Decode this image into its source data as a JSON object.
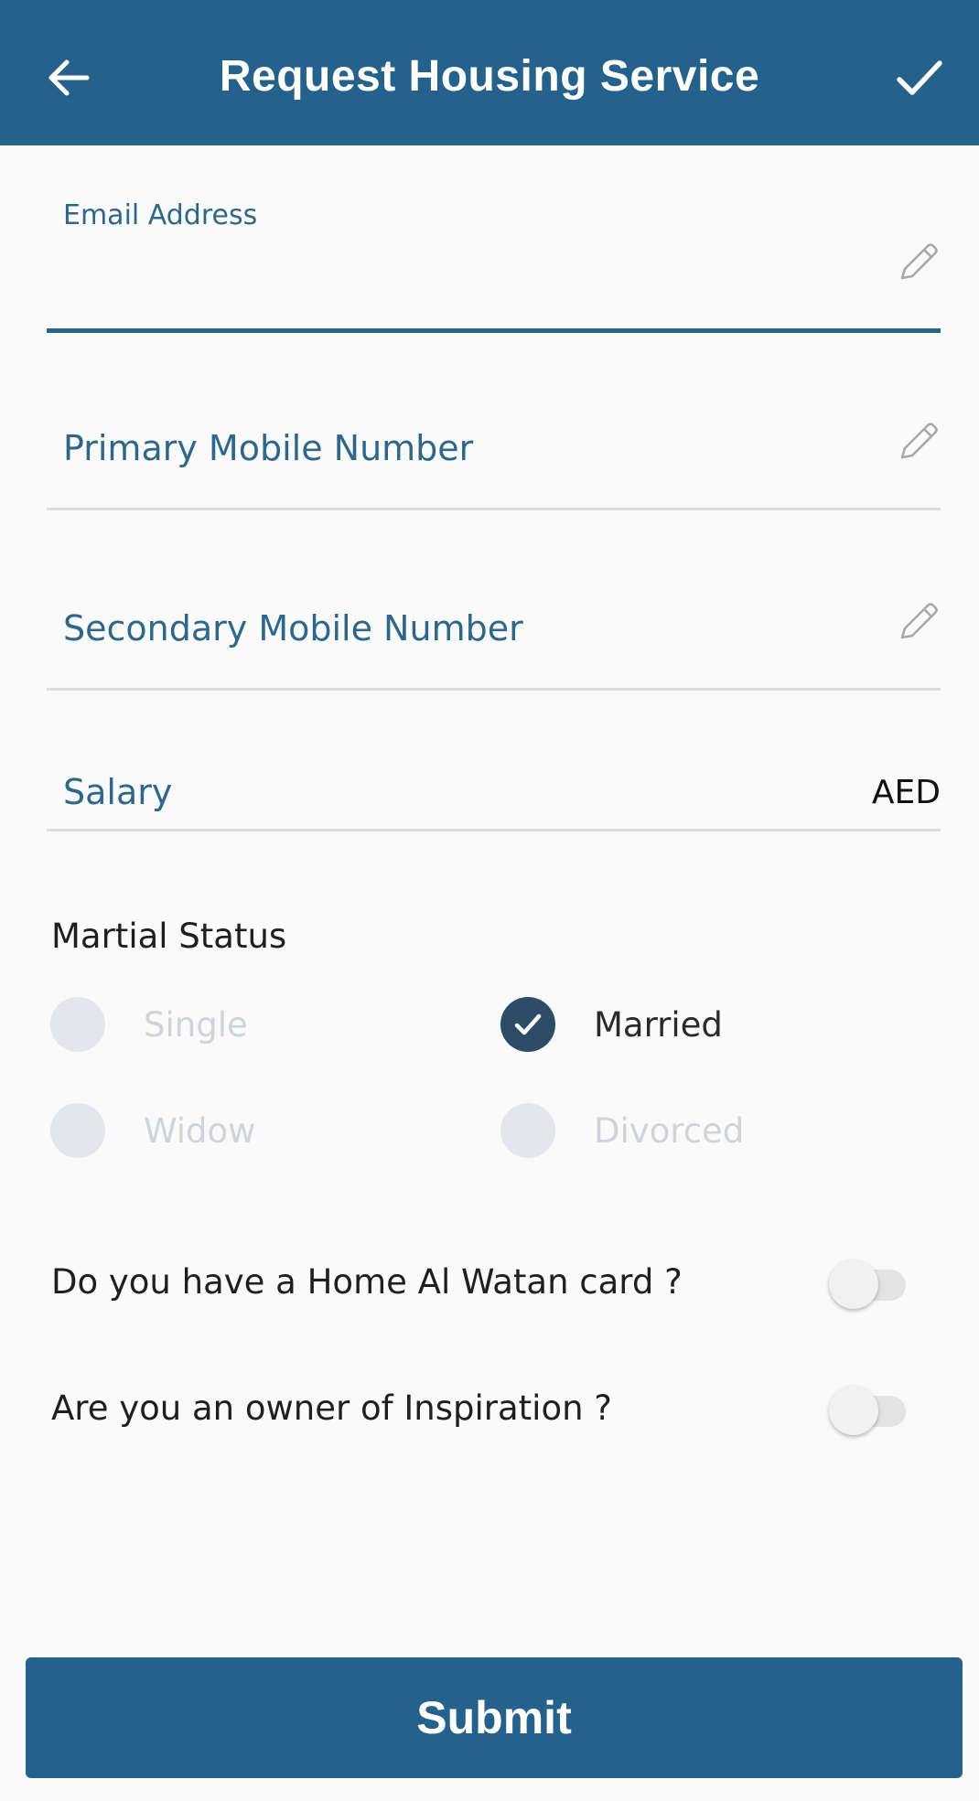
{
  "appbar": {
    "title": "Request Housing Service",
    "back_icon": "arrow-left-icon",
    "confirm_icon": "checkmark-icon"
  },
  "form": {
    "email": {
      "label": "Email Address",
      "value": "",
      "icon": "pencil-icon"
    },
    "primary_mobile": {
      "label": "Primary Mobile Number",
      "value": "",
      "icon": "pencil-icon"
    },
    "secondary_mobile": {
      "label": "Secondary Mobile Number",
      "value": "",
      "icon": "pencil-icon"
    },
    "salary": {
      "label": "Salary",
      "value": "",
      "suffix": "AED"
    }
  },
  "marital_status": {
    "title": "Martial Status",
    "options": [
      {
        "label": "Single",
        "selected": false
      },
      {
        "label": "Married",
        "selected": true
      },
      {
        "label": "Widow",
        "selected": false
      },
      {
        "label": "Divorced",
        "selected": false
      }
    ]
  },
  "questions": [
    {
      "text": "Do you have a Home Al Watan card ?",
      "enabled": false
    },
    {
      "text": "Are you an owner of Inspiration ?",
      "enabled": false
    }
  ],
  "submit_label": "Submit",
  "colors": {
    "primary": "#24628b",
    "label": "#2e6789",
    "radio_checked": "#2d4c67",
    "radio_unchecked": "#e3e6ed"
  }
}
